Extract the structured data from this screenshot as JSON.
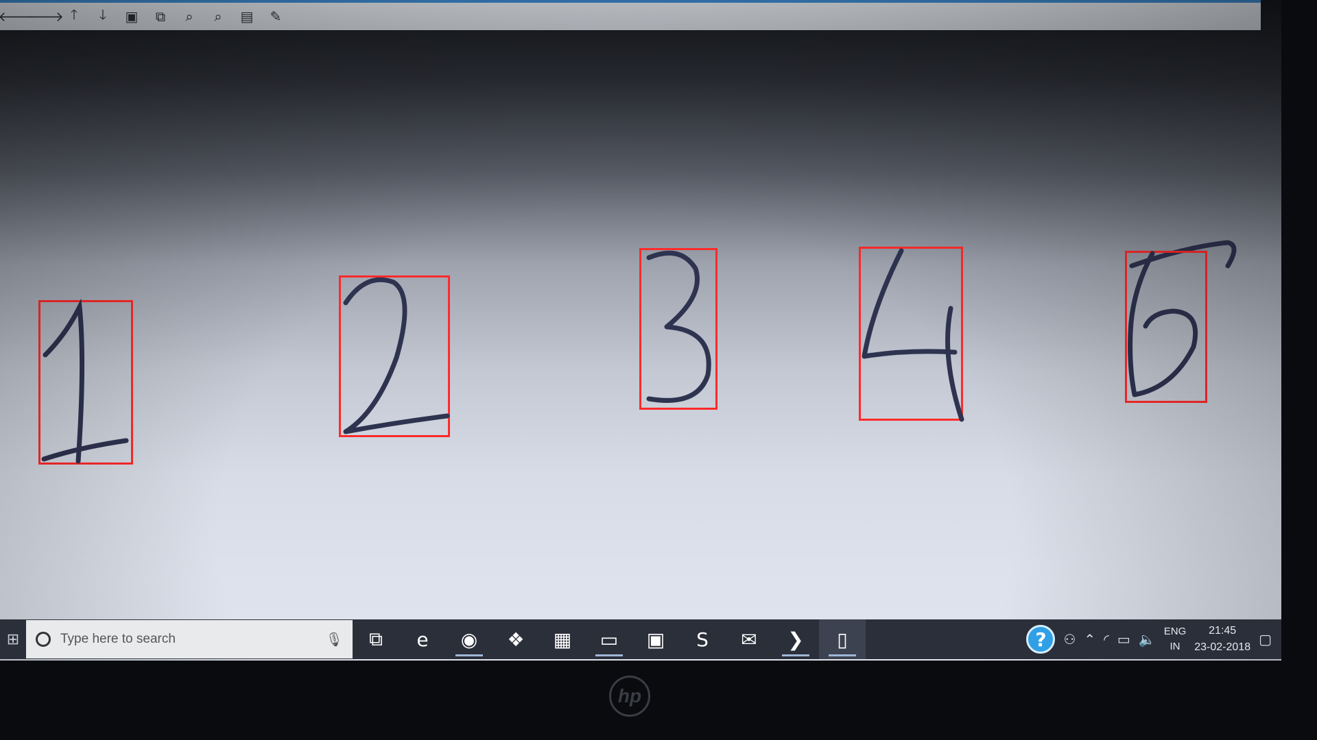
{
  "toolbar": {
    "buttons": [
      {
        "icon": "back-arrow-icon",
        "glyph": "🡐"
      },
      {
        "icon": "forward-arrow-icon",
        "glyph": "🡒"
      },
      {
        "icon": "up-arrow-icon",
        "glyph": "🡑"
      },
      {
        "icon": "down-arrow-icon",
        "glyph": "🡓"
      },
      {
        "icon": "image-icon",
        "glyph": "▣"
      },
      {
        "icon": "fit-icon",
        "glyph": "⧉"
      },
      {
        "icon": "zoom-in-icon",
        "glyph": "⌕"
      },
      {
        "icon": "zoom-out-icon",
        "glyph": "⌕"
      },
      {
        "icon": "save-icon",
        "glyph": "▤"
      },
      {
        "icon": "settings-icon",
        "glyph": "✎"
      }
    ]
  },
  "digits": [
    {
      "label": "1",
      "stroke_color": "#2e3350",
      "box_color": "#ff2a2a"
    },
    {
      "label": "2",
      "stroke_color": "#2e3350",
      "box_color": "#ff2a2a"
    },
    {
      "label": "3",
      "stroke_color": "#2e3350",
      "box_color": "#ff2a2a"
    },
    {
      "label": "4",
      "stroke_color": "#2e3350",
      "box_color": "#ff2a2a"
    },
    {
      "label": "5",
      "stroke_color": "#2e3350",
      "box_color": "#ff2a2a"
    }
  ],
  "taskbar": {
    "search_placeholder": "Type here to search",
    "apps": [
      {
        "name": "task-view",
        "icon": "task-view-icon",
        "glyph": "⧉"
      },
      {
        "name": "edge",
        "icon": "edge-icon",
        "glyph": "e"
      },
      {
        "name": "chrome",
        "icon": "chrome-icon",
        "glyph": "◉"
      },
      {
        "name": "dropbox",
        "icon": "dropbox-icon",
        "glyph": "❖"
      },
      {
        "name": "store",
        "icon": "store-icon",
        "glyph": "▦"
      },
      {
        "name": "file-explorer",
        "icon": "folder-icon",
        "glyph": "▭"
      },
      {
        "name": "app-blue",
        "icon": "app-icon",
        "glyph": "▣"
      },
      {
        "name": "sublime",
        "icon": "sublime-icon",
        "glyph": "S"
      },
      {
        "name": "mail",
        "icon": "mail-icon",
        "glyph": "✉"
      },
      {
        "name": "powershell",
        "icon": "powershell-icon",
        "glyph": "❯"
      },
      {
        "name": "document",
        "icon": "document-icon",
        "glyph": "▯"
      }
    ]
  },
  "tray": {
    "help_glyph": "?",
    "lang_line1": "ENG",
    "lang_line2": "IN",
    "time": "21:45",
    "date": "23-02-2018"
  },
  "brand": {
    "logo": "hp"
  },
  "colors": {
    "accent": "#3b84c6",
    "taskbar": "#2b2f3a",
    "box": "#ff2a2a"
  }
}
